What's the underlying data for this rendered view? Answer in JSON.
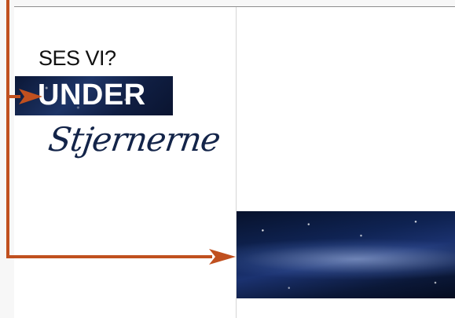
{
  "slide": {
    "headline_small": "SES VI?",
    "headline_big": "UNDER",
    "script_word": "Stjernerne"
  },
  "images": {
    "milky_way": "milky-way-night-sky"
  },
  "colors": {
    "arrow": "#c0501f",
    "script_text": "#132449",
    "headline_box": "#1d3466"
  }
}
